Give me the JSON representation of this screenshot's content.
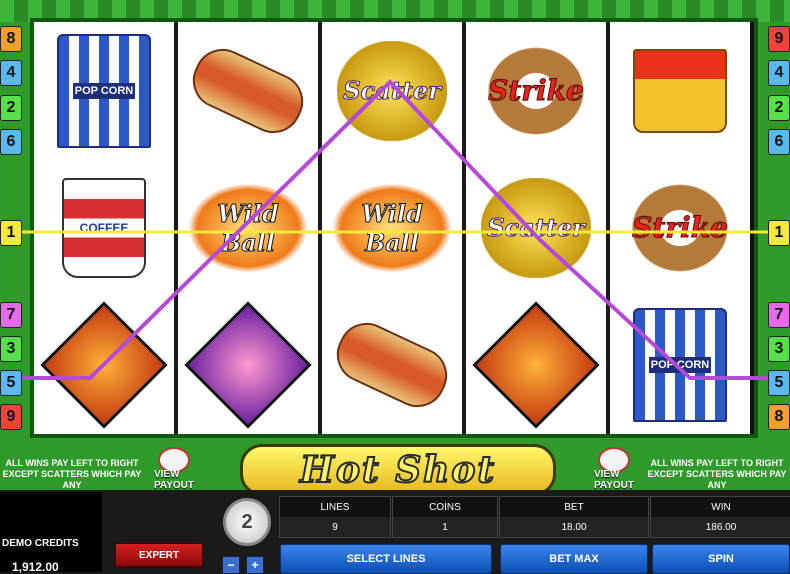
{
  "game_title": "Hot Shot",
  "left_badges": [
    "8",
    "4",
    "2",
    "6",
    "1",
    "7",
    "3",
    "5",
    "9"
  ],
  "right_badges": [
    "9",
    "4",
    "2",
    "6",
    "1",
    "7",
    "3",
    "5",
    "8"
  ],
  "badge_colors": {
    "1": "#f5ea3a",
    "2": "#57e04a",
    "3": "#57e04a",
    "4": "#5bb8f0",
    "5": "#5bb8f0",
    "6": "#5bb8f0",
    "7": "#e46be7",
    "8": "#f29f2e",
    "9": "#f0443a"
  },
  "pay_text_left": "ALL WINS PAY LEFT TO RIGHT\nEXCEPT SCATTERS WHICH PAY ANY",
  "pay_text_right": "ALL WINS PAY LEFT TO RIGHT\nEXCEPT SCATTERS WHICH PAY ANY",
  "view_payout_label": "VIEW\nPAYOUT",
  "reels": [
    [
      {
        "symbol": "popcorn-icon",
        "text": "POP CORN"
      },
      {
        "symbol": "coffee-icon",
        "text": "COFFEE"
      },
      {
        "symbol": "pitcher-icon",
        "text": ""
      }
    ],
    [
      {
        "symbol": "hotdog-icon",
        "text": ""
      },
      {
        "symbol": "wild-ball-icon",
        "text": "Wild Ball"
      },
      {
        "symbol": "batter-icon",
        "text": ""
      }
    ],
    [
      {
        "symbol": "scatter-icon",
        "text": "Scatter"
      },
      {
        "symbol": "wild-ball-icon",
        "text": "Wild Ball"
      },
      {
        "symbol": "hotdog-icon",
        "text": ""
      }
    ],
    [
      {
        "symbol": "strike-icon",
        "text": "Strike"
      },
      {
        "symbol": "scatter-icon",
        "text": "Scatter"
      },
      {
        "symbol": "pitcher-icon",
        "text": ""
      }
    ],
    [
      {
        "symbol": "fries-icon",
        "text": ""
      },
      {
        "symbol": "strike-icon",
        "text": "Strike"
      },
      {
        "symbol": "popcorn-icon",
        "text": "POP CORN"
      }
    ]
  ],
  "credits": {
    "label": "DEMO CREDITS",
    "value": "1,912.00"
  },
  "expert_label": "EXPERT",
  "coin_size": "2",
  "stats": {
    "lines": {
      "label": "LINES",
      "value": "9"
    },
    "coins": {
      "label": "COINS",
      "value": "1"
    },
    "bet": {
      "label": "BET",
      "value": "18.00"
    },
    "win": {
      "label": "WIN",
      "value": "186.00"
    }
  },
  "buttons": {
    "select_lines": "SELECT LINES",
    "bet_max": "BET MAX",
    "spin": "SPIN",
    "minus": "−",
    "plus": "+"
  },
  "paylines": {
    "line1_color": "#f5ea3a",
    "line5_color": "#b54ad9"
  }
}
